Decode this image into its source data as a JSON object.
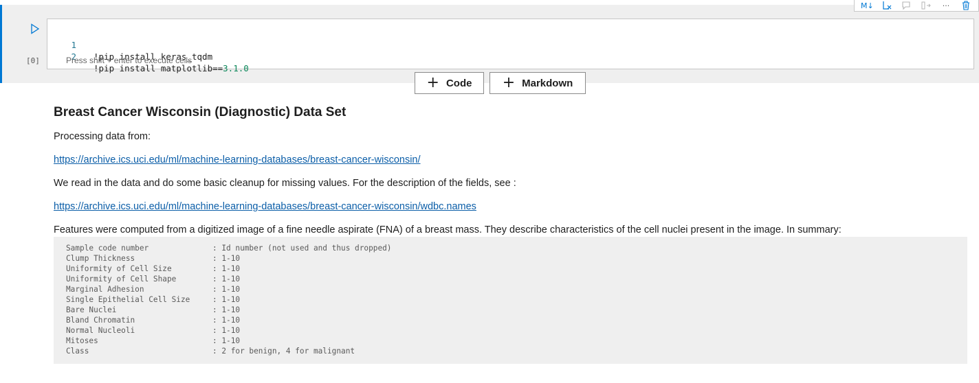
{
  "cell": {
    "execution_count": "[0]",
    "lines": [
      {
        "num": "1",
        "text": "!pip install keras_tqdm",
        "version": ""
      },
      {
        "num": "2",
        "text": "!pip install matplotlib==",
        "version": "3.1.0"
      }
    ],
    "hint": "Press shift + enter to execute cells",
    "toolbar": {
      "markdown_label": "M↓"
    }
  },
  "add_buttons": {
    "code_label": "Code",
    "markdown_label": "Markdown"
  },
  "markdown": {
    "title": "Breast Cancer Wisconsin (Diagnostic) Data Set",
    "p1": "Processing data from:",
    "link1": "https://archive.ics.uci.edu/ml/machine-learning-databases/breast-cancer-wisconsin/",
    "p2": "We read in the data and do some basic cleanup for missing values. For the description of the fields, see :",
    "link2": "https://archive.ics.uci.edu/ml/machine-learning-databases/breast-cancer-wisconsin/wdbc.names",
    "p3": "Features were computed from a digitized image of a fine needle aspirate (FNA) of a breast mass. They describe characteristics of the cell nuclei present in the image. In summary:",
    "fields": [
      {
        "name": "Sample code number",
        "value": ": Id number (not used and thus dropped)"
      },
      {
        "name": "Clump Thickness",
        "value": ": 1-10"
      },
      {
        "name": "Uniformity of Cell Size",
        "value": ": 1-10"
      },
      {
        "name": "Uniformity of Cell Shape",
        "value": ": 1-10"
      },
      {
        "name": "Marginal Adhesion",
        "value": ": 1-10"
      },
      {
        "name": "Single Epithelial Cell Size",
        "value": ": 1-10"
      },
      {
        "name": "Bare Nuclei",
        "value": ": 1-10"
      },
      {
        "name": "Bland Chromatin",
        "value": ": 1-10"
      },
      {
        "name": "Normal Nucleoli",
        "value": ": 1-10"
      },
      {
        "name": "Mitoses",
        "value": ": 1-10"
      },
      {
        "name": "Class",
        "value": ": 2 for benign, 4 for malignant"
      }
    ]
  },
  "colors": {
    "accent": "#0078d4",
    "link": "#0b5ea8",
    "line_number": "#237893",
    "number_literal": "#098658"
  }
}
